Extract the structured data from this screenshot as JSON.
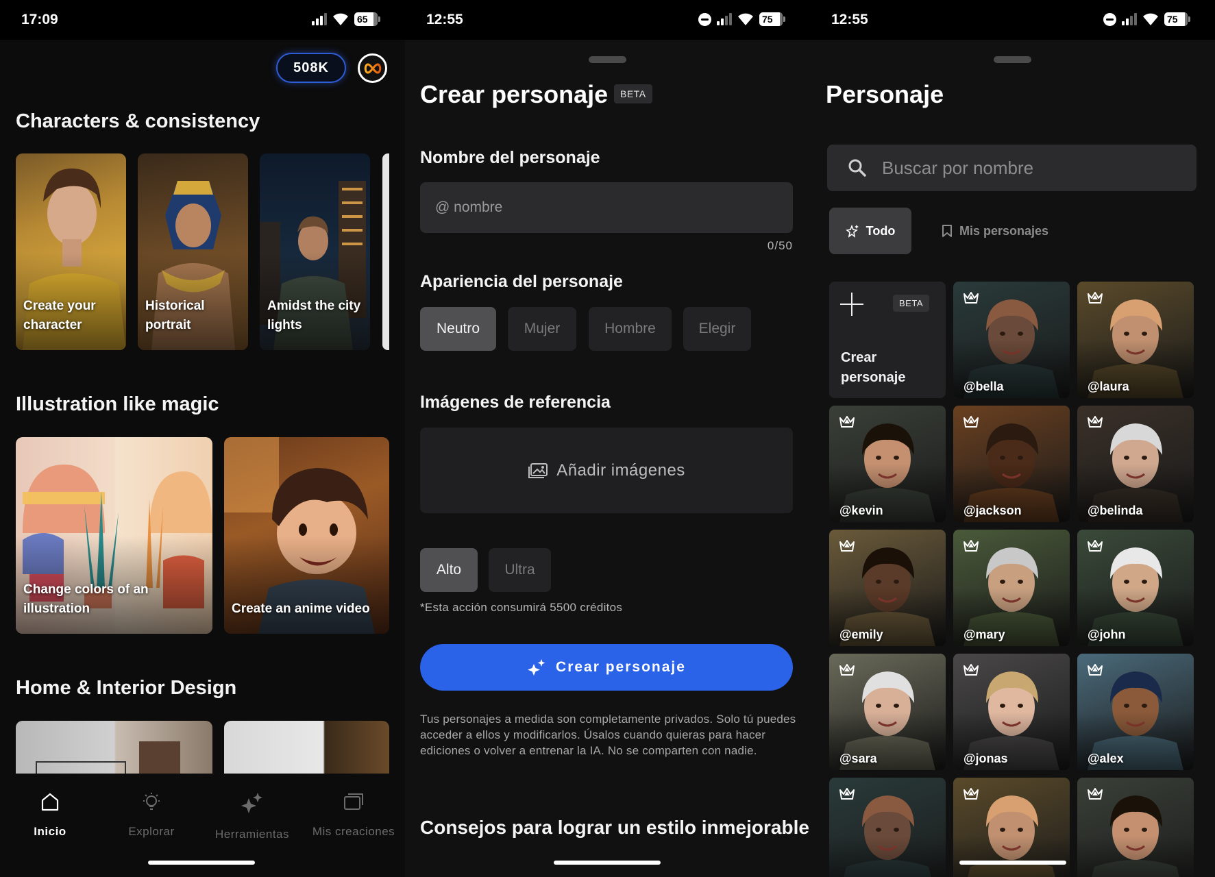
{
  "screen1": {
    "status": {
      "time": "17:09",
      "battery": "65"
    },
    "credits": "508K",
    "sections": [
      {
        "title": "Characters & consistency",
        "cards": [
          "Create your character",
          "Historical portrait",
          "Amidst the city lights"
        ]
      },
      {
        "title": "Illustration like magic",
        "cards": [
          "Change colors of an illustration",
          "Create an anime video"
        ]
      },
      {
        "title": "Home & Interior Design"
      }
    ],
    "nav": [
      {
        "label": "Inicio",
        "icon": "home-icon"
      },
      {
        "label": "Explorar",
        "icon": "lightbulb-icon"
      },
      {
        "label": "Herramientas",
        "icon": "sparkles-icon"
      },
      {
        "label": "Mis creaciones",
        "icon": "gallery-icon"
      }
    ]
  },
  "screen2": {
    "status": {
      "time": "12:55",
      "battery": "75"
    },
    "title": "Crear personaje",
    "beta": "BETA",
    "name_label": "Nombre del personaje",
    "name_placeholder": "@ nombre",
    "counter": "0/50",
    "appearance_label": "Apariencia del personaje",
    "appearance_options": [
      "Neutro",
      "Mujer",
      "Hombre",
      "Elegir"
    ],
    "reference_label": "Imágenes de referencia",
    "add_images": "Añadir imágenes",
    "quality_options": [
      "Alto",
      "Ultra"
    ],
    "credits_note": "*Esta acción consumirá 5500 créditos",
    "cta": "Crear personaje",
    "privacy": "Tus personajes a medida son completamente privados. Solo tú puedes acceder a ellos y modificarlos. Úsalos cuando quieras para hacer ediciones o volver a entrenar la IA. No se comparten con nadie.",
    "tips": "Consejos para lograr un estilo inmejorable"
  },
  "screen3": {
    "status": {
      "time": "12:55",
      "battery": "75"
    },
    "title": "Personaje",
    "search_placeholder": "Buscar por nombre",
    "tabs": [
      "Todo",
      "Mis personajes"
    ],
    "create_tile": {
      "label": "Crear personaje",
      "badge": "BETA"
    },
    "characters": [
      "@bella",
      "@laura",
      "@kevin",
      "@jackson",
      "@belinda",
      "@emily",
      "@mary",
      "@john",
      "@sara",
      "@jonas",
      "@alex"
    ]
  },
  "colors": {
    "accent": "#2a62e8",
    "background": "#111112",
    "chip_active": "#505052"
  }
}
